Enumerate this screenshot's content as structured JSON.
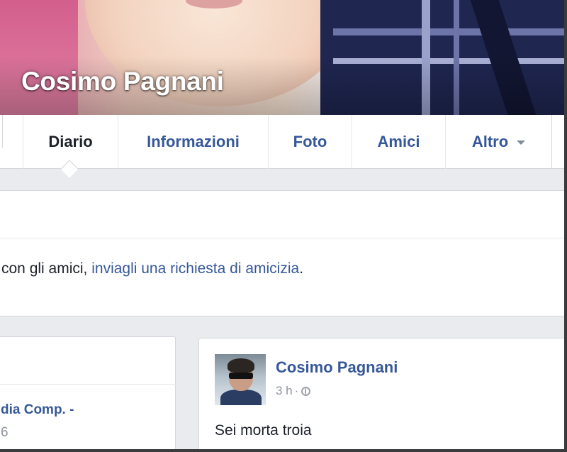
{
  "profile": {
    "name": "Cosimo Pagnani"
  },
  "tabs": [
    {
      "label": "Diario",
      "active": true
    },
    {
      "label": "Informazioni"
    },
    {
      "label": "Foto"
    },
    {
      "label": "Amici"
    },
    {
      "label": "Altro"
    }
  ],
  "friend_request": {
    "text_before": "con gli amici, ",
    "link_text": "inviagli una richiesta di amicizia",
    "text_after": "."
  },
  "left_card": {
    "link_text": "dia Comp. -",
    "sub_text": "6"
  },
  "post": {
    "author": "Cosimo Pagnani",
    "time": "3 h",
    "separator": "·",
    "privacy_icon": "globe-icon",
    "text": "Sei morta troia"
  },
  "colors": {
    "link": "#365899",
    "text": "#1d2129",
    "muted": "#90949c",
    "background": "#e9ebee"
  }
}
